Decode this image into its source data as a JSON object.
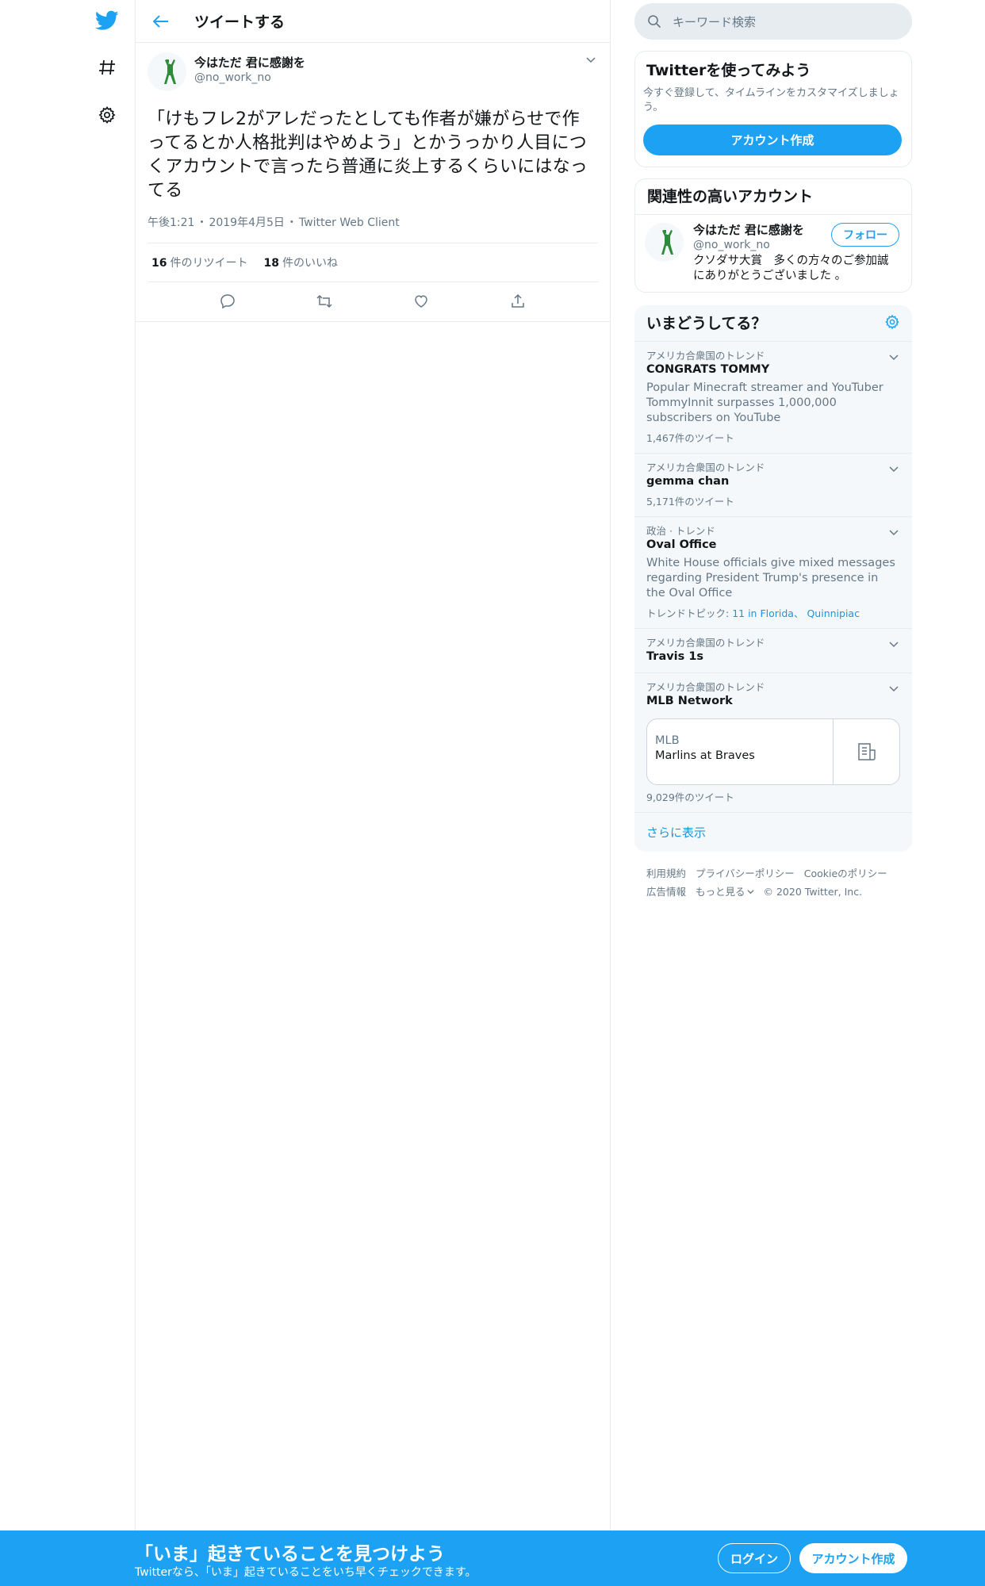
{
  "header": {
    "title": "ツイートする"
  },
  "tweet": {
    "author_name": "今はただ 君に感謝を",
    "author_handle": "@no_work_no",
    "text": "「けもフレ2がアレだったとしても作者が嫌がらせで作ってるとか人格批判はやめよう」とかうっかり人目につくアカウントで言ったら普通に炎上するくらいにはなってる",
    "time": "午後1:21",
    "date": "2019年4月5日",
    "source": "Twitter Web Client",
    "retweets": "16",
    "retweets_label": "件のリツイート",
    "likes": "18",
    "likes_label": "件のいいね"
  },
  "search": {
    "placeholder": "キーワード検索"
  },
  "signup_card": {
    "title": "Twitterを使ってみよう",
    "subtitle": "今すぐ登録して、タイムラインをカスタマイズしましょう。",
    "button": "アカウント作成"
  },
  "related": {
    "title": "関連性の高いアカウント",
    "name": "今はただ 君に感謝を",
    "handle": "@no_work_no",
    "follow": "フォロー",
    "bio": "クソダサ大賞　多くの方々のご参加誠にありがとうございました 。"
  },
  "trends": {
    "title": "いまどうしてる？",
    "items": [
      {
        "context": "アメリカ合衆国のトレンド",
        "name": "CONGRATS TOMMY",
        "desc": "Popular Minecraft streamer and YouTuber TommyInnit surpasses 1,000,000 subscribers on YouTube",
        "count": "1,467件のツイート"
      },
      {
        "context": "アメリカ合衆国のトレンド",
        "name": "gemma chan",
        "count": "5,171件のツイート"
      },
      {
        "context": "政治 · トレンド",
        "name": "Oval Office",
        "desc": "White House officials give mixed messages regarding President Trump's presence in the Oval Office",
        "topics_label": "トレンドトピック:",
        "topic1": "11 in Florida",
        "topic2": "Quinnipiac"
      },
      {
        "context": "アメリカ合衆国のトレンド",
        "name": "Travis 1s"
      },
      {
        "context": "アメリカ合衆国のトレンド",
        "name": "MLB Network",
        "event_league": "MLB",
        "event_title": "Marlins at Braves",
        "count": "9,029件のツイート"
      }
    ],
    "show_more": "さらに表示"
  },
  "footer": {
    "terms": "利用規約",
    "privacy": "プライバシーポリシー",
    "cookie": "Cookieのポリシー",
    "ads": "広告情報",
    "more": "もっと見る",
    "copyright": "© 2020 Twitter, Inc."
  },
  "banner": {
    "title": "「いま」起きていることを見つけよう",
    "subtitle": "Twitterなら、「いま」起きていることをいち早くチェックできます。",
    "login": "ログイン",
    "signup": "アカウント作成"
  },
  "colors": {
    "brand": "#1da1f2",
    "link": "#1b95e0",
    "muted": "#657786",
    "border": "#e6ecf0"
  },
  "icons": [
    "twitter-bird-icon",
    "hashtag-icon",
    "gear-icon",
    "back-arrow-icon",
    "chevron-down-icon",
    "reply-icon",
    "retweet-icon",
    "like-icon",
    "share-icon",
    "search-icon",
    "article-icon"
  ]
}
